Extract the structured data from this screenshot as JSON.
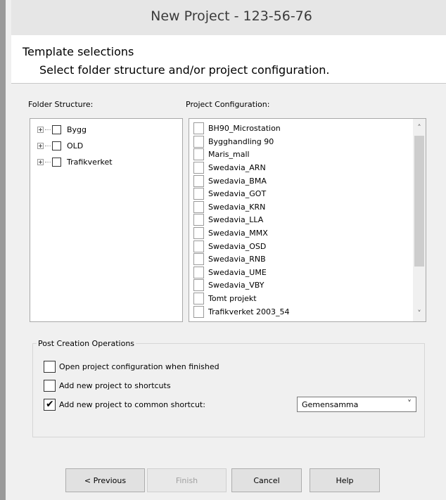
{
  "window": {
    "title": "New Project - 123-56-76"
  },
  "header": {
    "title": "Template selections",
    "subtitle": "Select folder structure and/or project configuration."
  },
  "folder_structure": {
    "label": "Folder Structure:",
    "items": [
      {
        "label": "Bygg",
        "checked": false
      },
      {
        "label": "OLD",
        "checked": false
      },
      {
        "label": "Trafikverket",
        "checked": false
      }
    ]
  },
  "project_configuration": {
    "label": "Project Configuration:",
    "items": [
      {
        "label": "BH90_Microstation",
        "checked": false
      },
      {
        "label": "Bygghandling 90",
        "checked": false
      },
      {
        "label": "Maris_mall",
        "checked": false
      },
      {
        "label": "Swedavia_ARN",
        "checked": false
      },
      {
        "label": "Swedavia_BMA",
        "checked": false
      },
      {
        "label": "Swedavia_GOT",
        "checked": false
      },
      {
        "label": "Swedavia_KRN",
        "checked": false
      },
      {
        "label": "Swedavia_LLA",
        "checked": false
      },
      {
        "label": "Swedavia_MMX",
        "checked": false
      },
      {
        "label": "Swedavia_OSD",
        "checked": false
      },
      {
        "label": "Swedavia_RNB",
        "checked": false
      },
      {
        "label": "Swedavia_UME",
        "checked": false
      },
      {
        "label": "Swedavia_VBY",
        "checked": false
      },
      {
        "label": "Tomt projekt",
        "checked": false
      },
      {
        "label": "Trafikverket 2003_54",
        "checked": false
      }
    ]
  },
  "post_creation": {
    "title": "Post Creation Operations",
    "options": [
      {
        "label": "Open project configuration when finished",
        "checked": false
      },
      {
        "label": "Add new project to shortcuts",
        "checked": false
      },
      {
        "label": "Add new project to common shortcut:",
        "checked": true
      }
    ],
    "shortcut_select": {
      "value": "Gemensamma"
    }
  },
  "buttons": {
    "previous": "< Previous",
    "finish": "Finish",
    "cancel": "Cancel",
    "help": "Help"
  },
  "icons": {
    "expander": "plus-expander-icon",
    "checkmark": "checkmark-icon",
    "scroll_up": "chevron-up-icon",
    "scroll_down": "chevron-down-icon",
    "dropdown": "chevron-down-icon"
  },
  "colors": {
    "window_bg": "#f0f0f0",
    "titlebar_bg": "#e6e6e6",
    "disabled_text": "#a0a0a0"
  }
}
